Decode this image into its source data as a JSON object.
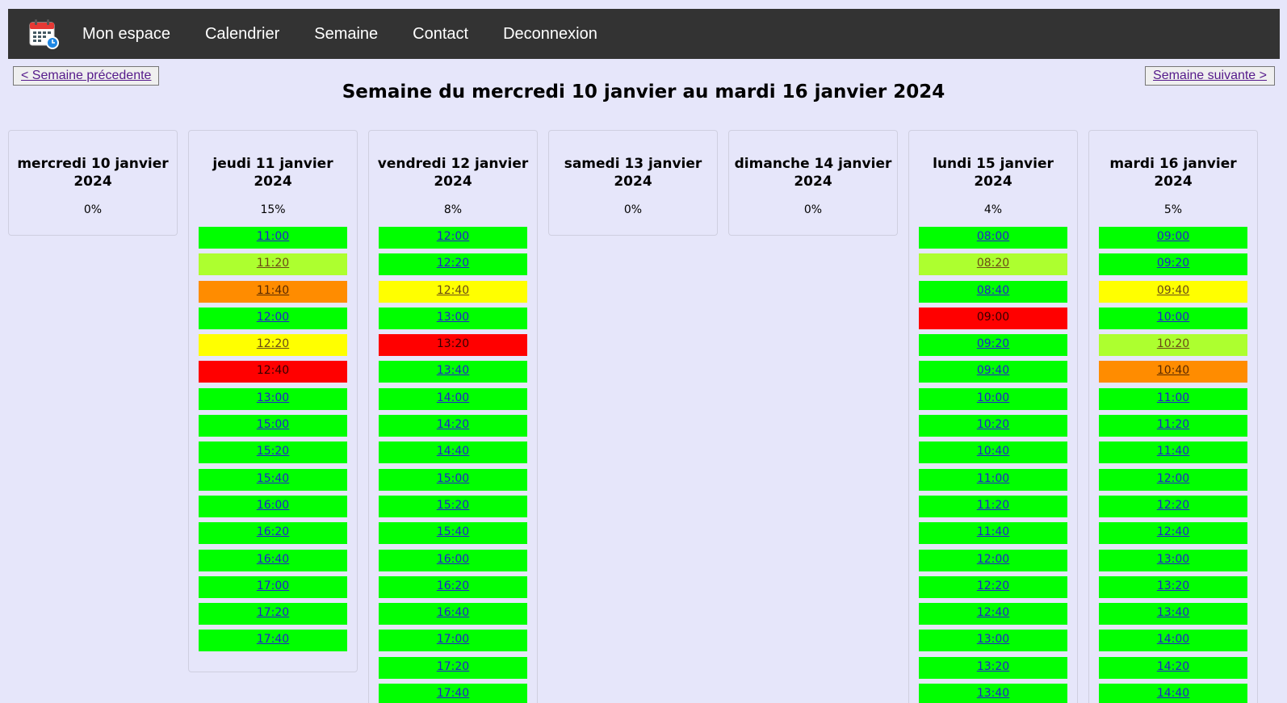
{
  "nav": {
    "links": [
      "Mon espace",
      "Calendrier",
      "Semaine",
      "Contact",
      "Deconnexion"
    ],
    "logo_icon": "calendar-clock-icon"
  },
  "week": {
    "prev_label": "< Semaine précedente",
    "next_label": "Semaine suivante >",
    "title": "Semaine du mercredi 10 janvier au mardi 16 janvier 2024"
  },
  "colors": {
    "background": "#e6e6fa",
    "navbar": "#333333",
    "green": "#00ff00",
    "yellowgreen": "#adff2f",
    "orange": "#ff8c00",
    "yellow": "#ffff00",
    "red": "#ff0000"
  },
  "days": [
    {
      "title": "mercredi 10 janvier 2024",
      "percent": "0%",
      "slots": []
    },
    {
      "title": "jeudi 11 janvier 2024",
      "percent": "15%",
      "slots": [
        {
          "time": "11:00",
          "status": "green"
        },
        {
          "time": "11:20",
          "status": "yellowgreen"
        },
        {
          "time": "11:40",
          "status": "orange"
        },
        {
          "time": "12:00",
          "status": "green"
        },
        {
          "time": "12:20",
          "status": "yellow"
        },
        {
          "time": "12:40",
          "status": "red"
        },
        {
          "time": "13:00",
          "status": "green"
        },
        {
          "time": "15:00",
          "status": "green"
        },
        {
          "time": "15:20",
          "status": "green"
        },
        {
          "time": "15:40",
          "status": "green"
        },
        {
          "time": "16:00",
          "status": "green"
        },
        {
          "time": "16:20",
          "status": "green"
        },
        {
          "time": "16:40",
          "status": "green"
        },
        {
          "time": "17:00",
          "status": "green"
        },
        {
          "time": "17:20",
          "status": "green"
        },
        {
          "time": "17:40",
          "status": "green"
        }
      ]
    },
    {
      "title": "vendredi 12 janvier 2024",
      "percent": "8%",
      "slots": [
        {
          "time": "12:00",
          "status": "green"
        },
        {
          "time": "12:20",
          "status": "green"
        },
        {
          "time": "12:40",
          "status": "yellow"
        },
        {
          "time": "13:00",
          "status": "green"
        },
        {
          "time": "13:20",
          "status": "red"
        },
        {
          "time": "13:40",
          "status": "green"
        },
        {
          "time": "14:00",
          "status": "green"
        },
        {
          "time": "14:20",
          "status": "green"
        },
        {
          "time": "14:40",
          "status": "green"
        },
        {
          "time": "15:00",
          "status": "green"
        },
        {
          "time": "15:20",
          "status": "green"
        },
        {
          "time": "15:40",
          "status": "green"
        },
        {
          "time": "16:00",
          "status": "green"
        },
        {
          "time": "16:20",
          "status": "green"
        },
        {
          "time": "16:40",
          "status": "green"
        },
        {
          "time": "17:00",
          "status": "green"
        },
        {
          "time": "17:20",
          "status": "green"
        },
        {
          "time": "17:40",
          "status": "green"
        }
      ]
    },
    {
      "title": "samedi 13 janvier 2024",
      "percent": "0%",
      "slots": []
    },
    {
      "title": "dimanche 14 janvier 2024",
      "percent": "0%",
      "slots": []
    },
    {
      "title": "lundi 15 janvier 2024",
      "percent": "4%",
      "slots": [
        {
          "time": "08:00",
          "status": "green"
        },
        {
          "time": "08:20",
          "status": "yellowgreen"
        },
        {
          "time": "08:40",
          "status": "green"
        },
        {
          "time": "09:00",
          "status": "red"
        },
        {
          "time": "09:20",
          "status": "green"
        },
        {
          "time": "09:40",
          "status": "green"
        },
        {
          "time": "10:00",
          "status": "green"
        },
        {
          "time": "10:20",
          "status": "green"
        },
        {
          "time": "10:40",
          "status": "green"
        },
        {
          "time": "11:00",
          "status": "green"
        },
        {
          "time": "11:20",
          "status": "green"
        },
        {
          "time": "11:40",
          "status": "green"
        },
        {
          "time": "12:00",
          "status": "green"
        },
        {
          "time": "12:20",
          "status": "green"
        },
        {
          "time": "12:40",
          "status": "green"
        },
        {
          "time": "13:00",
          "status": "green"
        },
        {
          "time": "13:20",
          "status": "green"
        },
        {
          "time": "13:40",
          "status": "green"
        }
      ]
    },
    {
      "title": "mardi 16 janvier 2024",
      "percent": "5%",
      "slots": [
        {
          "time": "09:00",
          "status": "green"
        },
        {
          "time": "09:20",
          "status": "green"
        },
        {
          "time": "09:40",
          "status": "yellow"
        },
        {
          "time": "10:00",
          "status": "green"
        },
        {
          "time": "10:20",
          "status": "yellowgreen"
        },
        {
          "time": "10:40",
          "status": "orange"
        },
        {
          "time": "11:00",
          "status": "green"
        },
        {
          "time": "11:20",
          "status": "green"
        },
        {
          "time": "11:40",
          "status": "green"
        },
        {
          "time": "12:00",
          "status": "green"
        },
        {
          "time": "12:20",
          "status": "green"
        },
        {
          "time": "12:40",
          "status": "green"
        },
        {
          "time": "13:00",
          "status": "green"
        },
        {
          "time": "13:20",
          "status": "green"
        },
        {
          "time": "13:40",
          "status": "green"
        },
        {
          "time": "14:00",
          "status": "green"
        },
        {
          "time": "14:20",
          "status": "green"
        },
        {
          "time": "14:40",
          "status": "green"
        }
      ]
    }
  ]
}
